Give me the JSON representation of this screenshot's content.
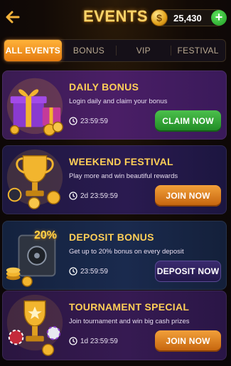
{
  "header": {
    "title": "EVENTS",
    "balance": "25,430",
    "coin_symbol": "$",
    "add_symbol": "+"
  },
  "tabs": [
    {
      "label": "ALL EVENTS",
      "active": true
    },
    {
      "label": "BONUS",
      "active": false
    },
    {
      "label": "VIP",
      "active": false
    },
    {
      "label": "FESTIVAL",
      "active": false
    }
  ],
  "events": [
    {
      "title": "DAILY BONUS",
      "desc": "Login daily and claim your bonus",
      "timer": "23:59:59",
      "button": "CLAIM NOW",
      "art": "gift-box-icon"
    },
    {
      "title": "WEEKEND FESTIVAL",
      "desc": "Play more and win beautiful rewards",
      "timer": "2d 23:59:59",
      "button": "JOIN NOW",
      "art": "trophy-icon"
    },
    {
      "title": "DEPOSIT BONUS",
      "desc": "Get up to 20% bonus on every deposit",
      "timer": "23:59:59",
      "button": "DEPOSIT NOW",
      "art": "safe-icon",
      "badge": "20%"
    },
    {
      "title": "TOURNAMENT SPECIAL",
      "desc": "Join tournament and win big cash prizes",
      "timer": "1d 23:59:59",
      "button": "JOIN NOW",
      "art": "trophy-chips-icon"
    }
  ],
  "colors": {
    "accent_gold": "#ffcf57",
    "tab_active": "#f0921f",
    "claim_green": "#2ea232",
    "join_orange": "#e07a1a",
    "deposit_purple": "#2c2060"
  }
}
